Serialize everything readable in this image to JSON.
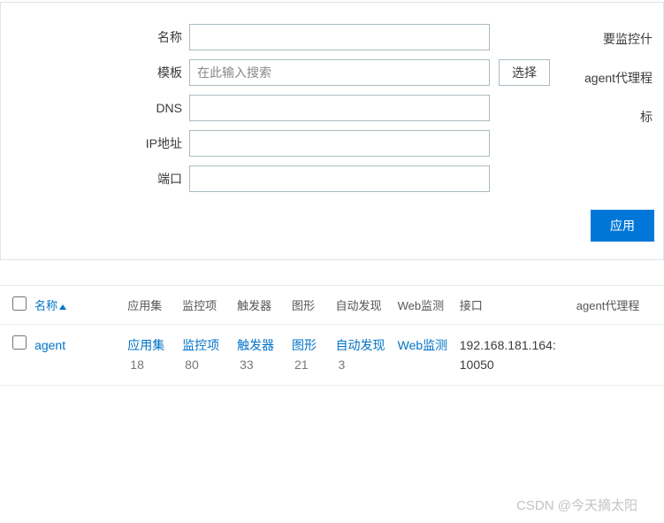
{
  "filter": {
    "name_label": "名称",
    "template_label": "模板",
    "template_placeholder": "在此输入搜索",
    "select_btn": "选择",
    "dns_label": "DNS",
    "ip_label": "IP地址",
    "port_label": "端口",
    "right1": "要监控什",
    "right2": "agent代理程",
    "right3": "标",
    "apply_btn": "应用"
  },
  "table": {
    "headers": {
      "name": "名称",
      "app": "应用集",
      "mon": "监控项",
      "trig": "触发器",
      "graph": "图形",
      "disc": "自动发现",
      "web": "Web监测",
      "if": "接口",
      "proxy": "agent代理程"
    },
    "row": {
      "name": "agent",
      "app_label": "应用集",
      "app_count": "18",
      "mon_label": "监控项",
      "mon_count": "80",
      "trig_label": "触发器",
      "trig_count": "33",
      "graph_label": "图形",
      "graph_count": "21",
      "disc_label": "自动发现",
      "disc_count": "3",
      "web_label": "Web监测",
      "if_value": "192.168.181.164: 10050"
    }
  },
  "watermark": "CSDN @今天摘太阳"
}
